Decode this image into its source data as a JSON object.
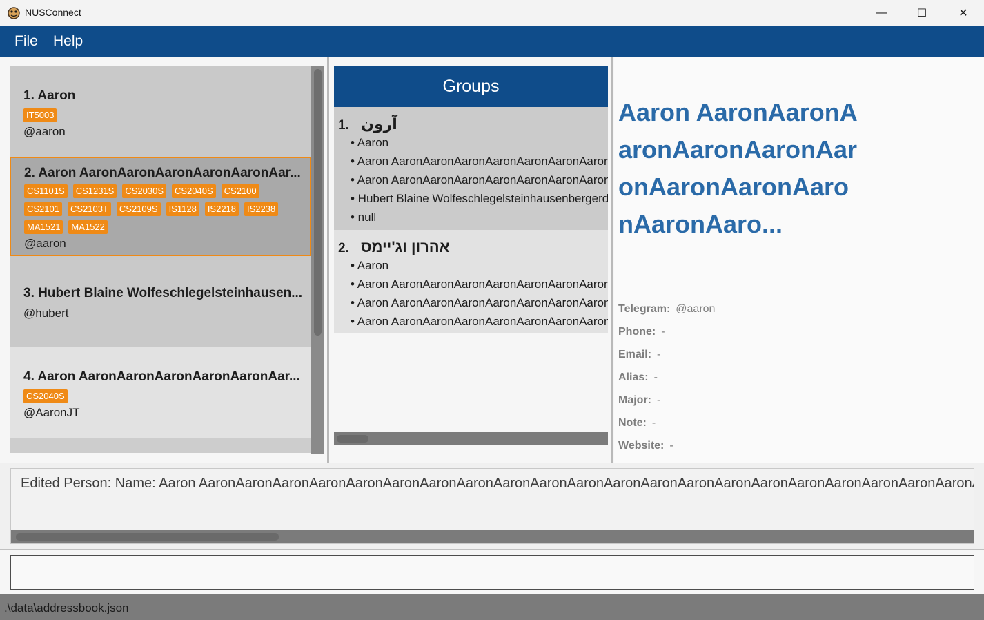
{
  "window": {
    "title": "NUSConnect",
    "minimize_glyph": "—",
    "maximize_glyph": "☐",
    "close_glyph": "✕"
  },
  "menu": {
    "file": "File",
    "help": "Help"
  },
  "persons": [
    {
      "name": "1.  Aaron",
      "tags": [
        "IT5003"
      ],
      "handle": "@aaron"
    },
    {
      "name": "2.  Aaron AaronAaronAaronAaronAaronAar...",
      "tags": [
        "CS1101S",
        "CS1231S",
        "CS2030S",
        "CS2040S",
        "CS2100",
        "CS2101",
        "CS2103T",
        "CS2109S",
        "IS1128",
        "IS2218",
        "IS2238",
        "MA1521",
        "MA1522"
      ],
      "handle": "@aaron"
    },
    {
      "name": "3.  Hubert Blaine Wolfeschlegelsteinhausen...",
      "tags": [],
      "handle": "@hubert"
    },
    {
      "name": "4.  Aaron AaronAaronAaronAaronAaronAar...",
      "tags": [
        "CS2040S"
      ],
      "handle": "@AaronJT"
    }
  ],
  "groups": {
    "header": "Groups",
    "items": [
      {
        "index": "1.",
        "name": "آرون",
        "members": [
          "• Aaron",
          "• Aaron AaronAaronAaronAaronAaronAaronAaron",
          "• Aaron AaronAaronAaronAaronAaronAaronAaron",
          "• Hubert Blaine Wolfeschlegelsteinhausenbergerdorff",
          "• null"
        ]
      },
      {
        "index": "2.",
        "name": "אהרון וג'יימס",
        "members": [
          "• Aaron",
          "• Aaron AaronAaronAaronAaronAaronAaronAaron",
          "• Aaron AaronAaronAaronAaronAaronAaronAaron",
          "• Aaron AaronAaronAaronAaronAaronAaronAaron"
        ]
      }
    ]
  },
  "detail": {
    "name": "Aaron AaronAaronAaronAaronAaronAaronAaronAaronAaronAaronAaro...",
    "fields": [
      {
        "label": "Telegram:",
        "value": "@aaron"
      },
      {
        "label": "Phone:",
        "value": "-"
      },
      {
        "label": "Email:",
        "value": "-"
      },
      {
        "label": "Alias:",
        "value": "-"
      },
      {
        "label": "Major:",
        "value": "-"
      },
      {
        "label": "Note:",
        "value": "-"
      },
      {
        "label": "Website:",
        "value": "-"
      }
    ]
  },
  "result": {
    "text": "Edited Person: Name: Aaron AaronAaronAaronAaronAaronAaronAaronAaronAaronAaronAaronAaronAaronAaronAaronAaronAaronAaronAaronAaronAaronAaronAaron"
  },
  "command": {
    "value": "",
    "placeholder": ""
  },
  "status": {
    "path": ".\\data\\addressbook.json"
  },
  "colors": {
    "primary": "#0f4c8a",
    "tag": "#ef8a16",
    "detail_name": "#2a6aa8",
    "selected_border": "#ef8a16"
  }
}
